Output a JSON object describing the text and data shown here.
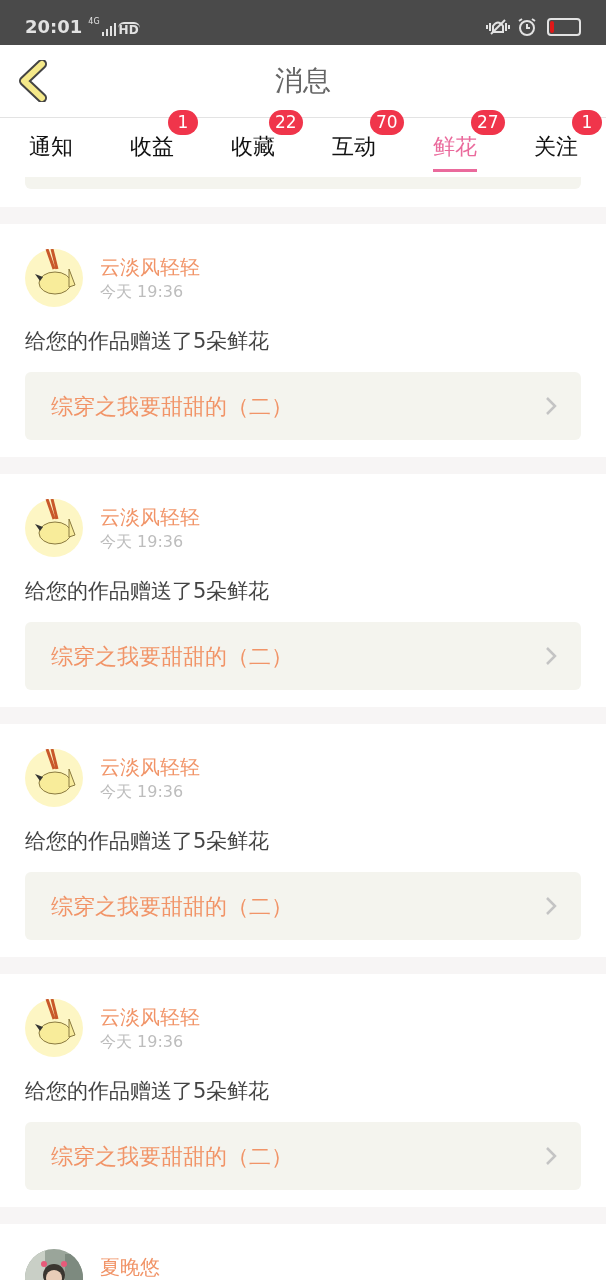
{
  "status_bar": {
    "time": "20:01",
    "network": "4G",
    "call_label": "HD"
  },
  "header": {
    "title": "消息"
  },
  "tabs": [
    {
      "label": "通知",
      "selected": false
    },
    {
      "label": "收益",
      "badge": "1",
      "selected": false
    },
    {
      "label": "收藏",
      "badge": "22",
      "selected": false
    },
    {
      "label": "互动",
      "badge": "70",
      "selected": false
    },
    {
      "label": "鲜花",
      "badge": "27",
      "selected": true
    },
    {
      "label": "关注",
      "badge": "1",
      "selected": false
    }
  ],
  "messages": [
    {
      "kind": "cartoon",
      "sender": "云淡风轻轻",
      "time": "今天 19:36",
      "text": "给您的作品赠送了5朵鲜花",
      "work": "综穿之我要甜甜的（二）"
    },
    {
      "kind": "cartoon",
      "sender": "云淡风轻轻",
      "time": "今天 19:36",
      "text": "给您的作品赠送了5朵鲜花",
      "work": "综穿之我要甜甜的（二）"
    },
    {
      "kind": "cartoon",
      "sender": "云淡风轻轻",
      "time": "今天 19:36",
      "text": "给您的作品赠送了5朵鲜花",
      "work": "综穿之我要甜甜的（二）"
    },
    {
      "kind": "cartoon",
      "sender": "云淡风轻轻",
      "time": "今天 19:36",
      "text": "给您的作品赠送了5朵鲜花",
      "work": "综穿之我要甜甜的（二）"
    },
    {
      "kind": "picture",
      "sender": "夏晚悠"
    }
  ]
}
